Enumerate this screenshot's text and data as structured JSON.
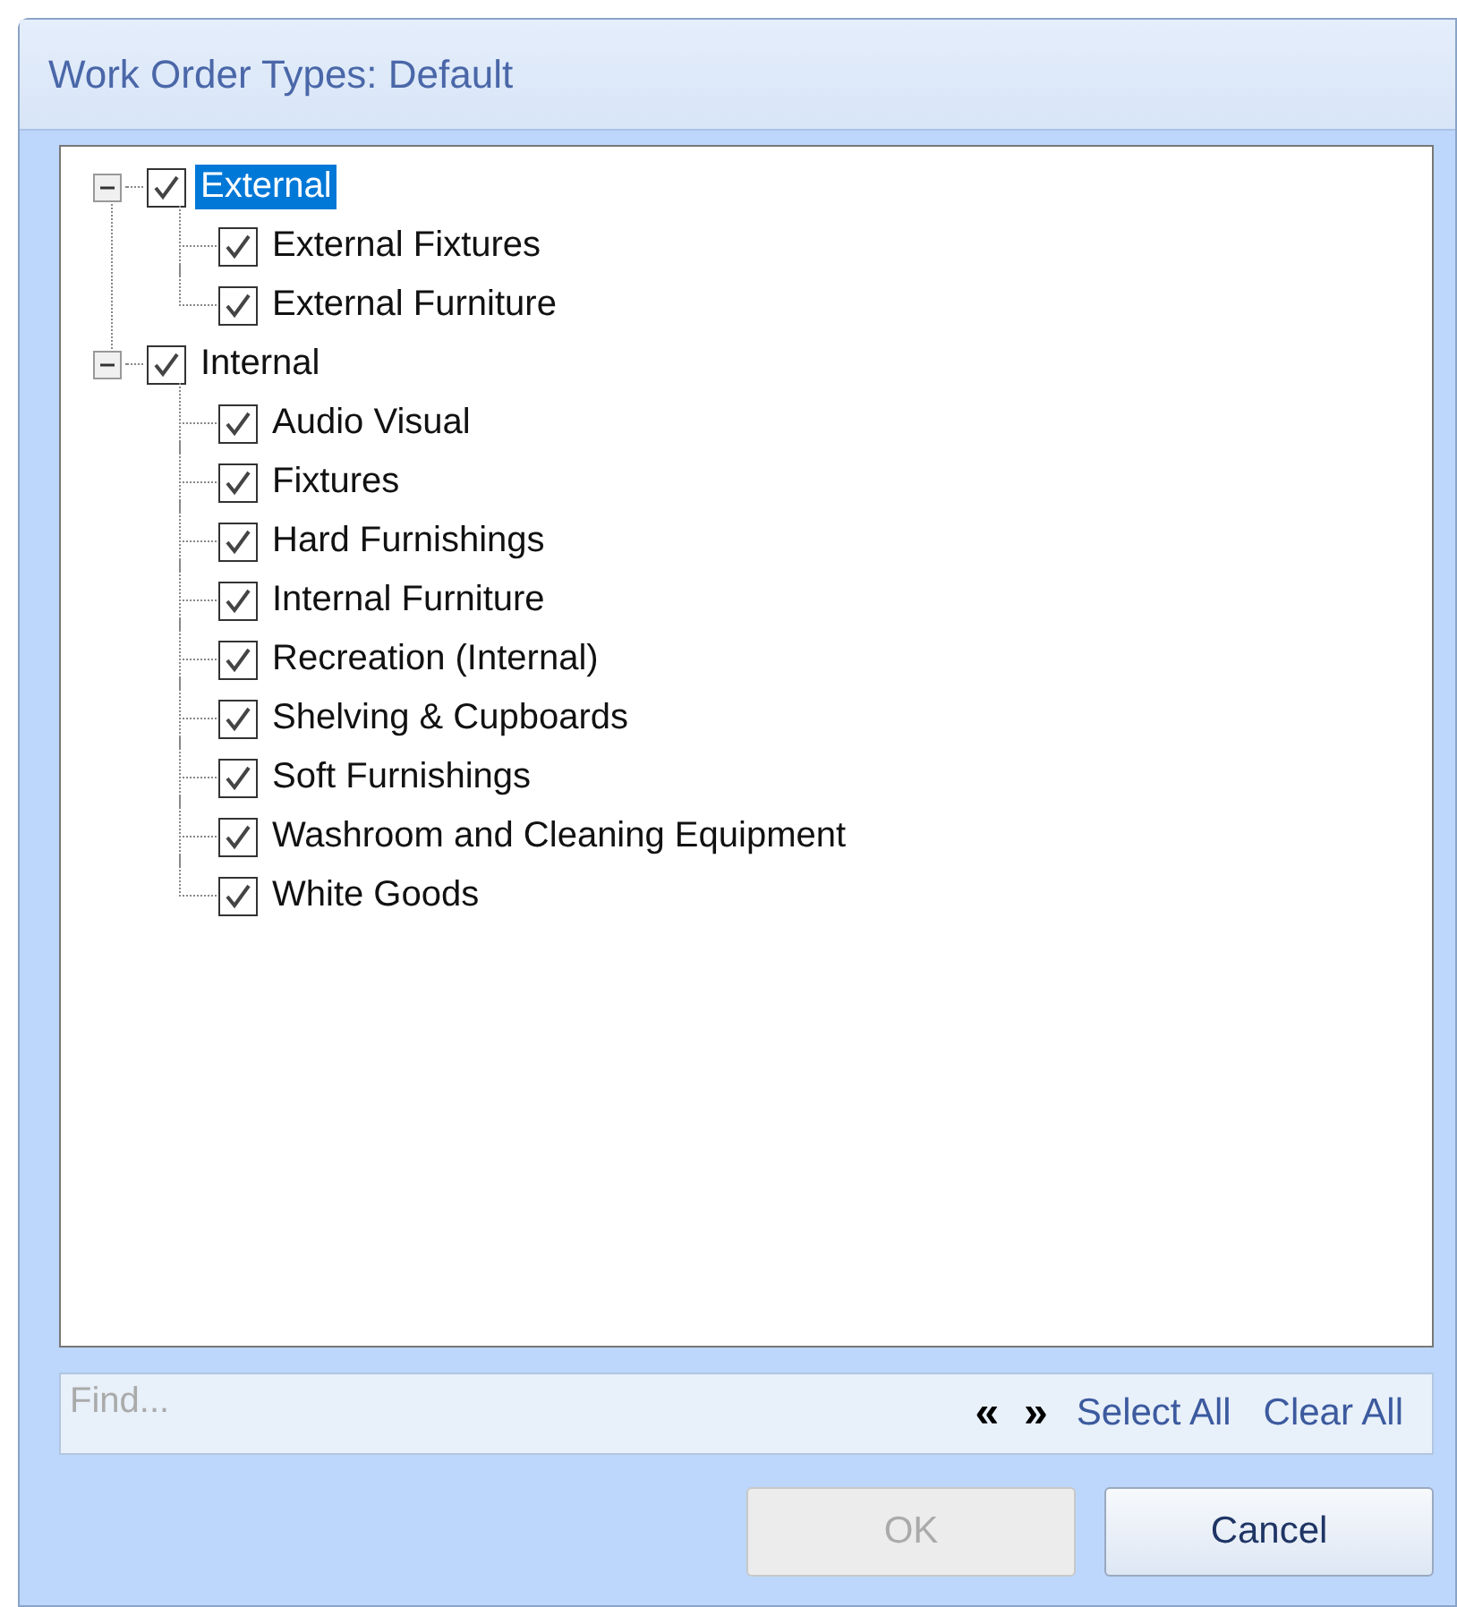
{
  "window": {
    "title": "Work Order Types: Default"
  },
  "tree": [
    {
      "label": "External",
      "checked": true,
      "selected": true,
      "expanded": true,
      "children": [
        {
          "label": "External Fixtures",
          "checked": true,
          "selected": false
        },
        {
          "label": "External Furniture",
          "checked": true,
          "selected": false
        }
      ]
    },
    {
      "label": "Internal",
      "checked": true,
      "selected": false,
      "expanded": true,
      "children": [
        {
          "label": "Audio Visual",
          "checked": true,
          "selected": false
        },
        {
          "label": "Fixtures",
          "checked": true,
          "selected": false
        },
        {
          "label": "Hard Furnishings",
          "checked": true,
          "selected": false
        },
        {
          "label": "Internal Furniture",
          "checked": true,
          "selected": false
        },
        {
          "label": "Recreation (Internal)",
          "checked": true,
          "selected": false
        },
        {
          "label": "Shelving & Cupboards",
          "checked": true,
          "selected": false
        },
        {
          "label": "Soft Furnishings",
          "checked": true,
          "selected": false
        },
        {
          "label": "Washroom and Cleaning Equipment",
          "checked": true,
          "selected": false
        },
        {
          "label": "White Goods",
          "checked": true,
          "selected": false
        }
      ]
    }
  ],
  "find": {
    "placeholder": "Find...",
    "prev": "«",
    "next": "»",
    "select_all": "Select All",
    "clear_all": "Clear All"
  },
  "buttons": [
    {
      "label": "OK",
      "disabled": true
    },
    {
      "label": "Cancel",
      "disabled": false
    }
  ]
}
